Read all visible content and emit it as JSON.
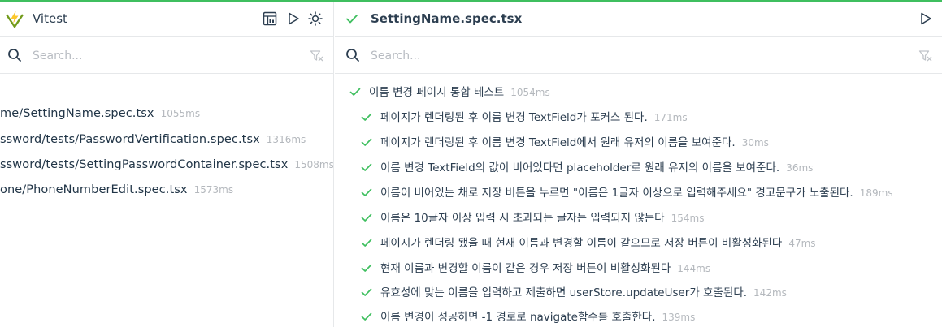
{
  "colors": {
    "accent": "#3fbf5f",
    "pass": "#3fbf5f",
    "muted": "#b4b8bd"
  },
  "app": {
    "title": "Vitest"
  },
  "left": {
    "search_placeholder": "Search...",
    "files": [
      {
        "name": "me/SettingName.spec.tsx",
        "duration": "1055ms"
      },
      {
        "name": "ssword/tests/PasswordVertification.spec.tsx",
        "duration": "1316ms"
      },
      {
        "name": "ssword/tests/SettingPasswordContainer.spec.tsx",
        "duration": "1508ms"
      },
      {
        "name": "one/PhoneNumberEdit.spec.tsx",
        "duration": "1573ms"
      }
    ]
  },
  "right": {
    "file_title": "SettingName.spec.tsx",
    "search_placeholder": "Search...",
    "suite": {
      "name": "이름 변경 페이지 통합 테스트",
      "duration": "1054ms"
    },
    "tests": [
      {
        "name": "페이지가 렌더링된 후 이름 변경 TextField가 포커스 된다.",
        "duration": "171ms"
      },
      {
        "name": "페이지가 렌더링된 후 이름 변경 TextField에서 원래 유저의 이름을 보여준다.",
        "duration": "30ms"
      },
      {
        "name": "이름 변경 TextField의 값이 비어있다면 placeholder로 원래 유저의 이름을 보여준다.",
        "duration": "36ms"
      },
      {
        "name": "이름이 비어있는 채로 저장 버튼을 누르면 \"이름은 1글자 이상으로 입력해주세요\" 경고문구가 노출된다.",
        "duration": "189ms"
      },
      {
        "name": "이름은 10글자 이상 입력 시 초과되는 글자는 입력되지 않는다",
        "duration": "154ms"
      },
      {
        "name": "페이지가 렌더링 됐을 때 현재 이름과 변경할 이름이 같으므로 저장 버튼이 비활성화된다",
        "duration": "47ms"
      },
      {
        "name": "현재 이름과 변경할 이름이 같은 경우 저장 버튼이 비활성화된다",
        "duration": "144ms"
      },
      {
        "name": "유효성에 맞는 이름을 입력하고 제출하면 userStore.updateUser가 호출된다.",
        "duration": "142ms"
      },
      {
        "name": "이름 변경이 성공하면 -1 경로로 navigate함수를 호출한다.",
        "duration": "139ms"
      }
    ]
  }
}
